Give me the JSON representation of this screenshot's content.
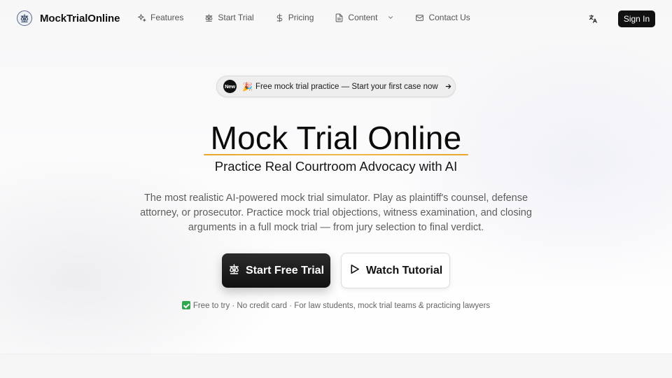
{
  "brand": {
    "name": "MockTrialOnline",
    "logo_icon": "scales-icon"
  },
  "nav": {
    "links": [
      {
        "label": "Features",
        "icon": "sparkles-icon"
      },
      {
        "label": "Start Trial",
        "icon": "scales-icon"
      },
      {
        "label": "Pricing",
        "icon": "dollar-icon"
      },
      {
        "label": "Content",
        "icon": "document-icon",
        "dropdown": true
      },
      {
        "label": "Contact Us",
        "icon": "mail-icon"
      }
    ],
    "language_icon": "translate-icon",
    "signin_label": "Sign In"
  },
  "announcement": {
    "badge": "New",
    "emoji": "🎉",
    "text": "Free mock trial practice — Start your first case now",
    "arrow_icon": "arrow-right-icon"
  },
  "hero": {
    "title": "Mock Trial Online",
    "subtitle": "Practice Real Courtroom Advocacy with AI",
    "description": "The most realistic AI-powered mock trial simulator. Play as plaintiff's counsel, defense attorney, or prosecutor. Practice mock trial objections, witness examination, and closing arguments in a full mock trial — from jury selection to final verdict.",
    "primary_cta": {
      "label": "Start Free Trial",
      "icon": "scales-icon"
    },
    "secondary_cta": {
      "label": "Watch Tutorial",
      "icon": "play-icon"
    },
    "trust_line": "Free to try · No credit card · For law students, mock trial teams & practicing lawyers"
  },
  "colors": {
    "primary": "#111111",
    "underline_accent": "#e7a52b",
    "check_green": "#2fa84f",
    "text_muted": "#5d5d5d"
  }
}
